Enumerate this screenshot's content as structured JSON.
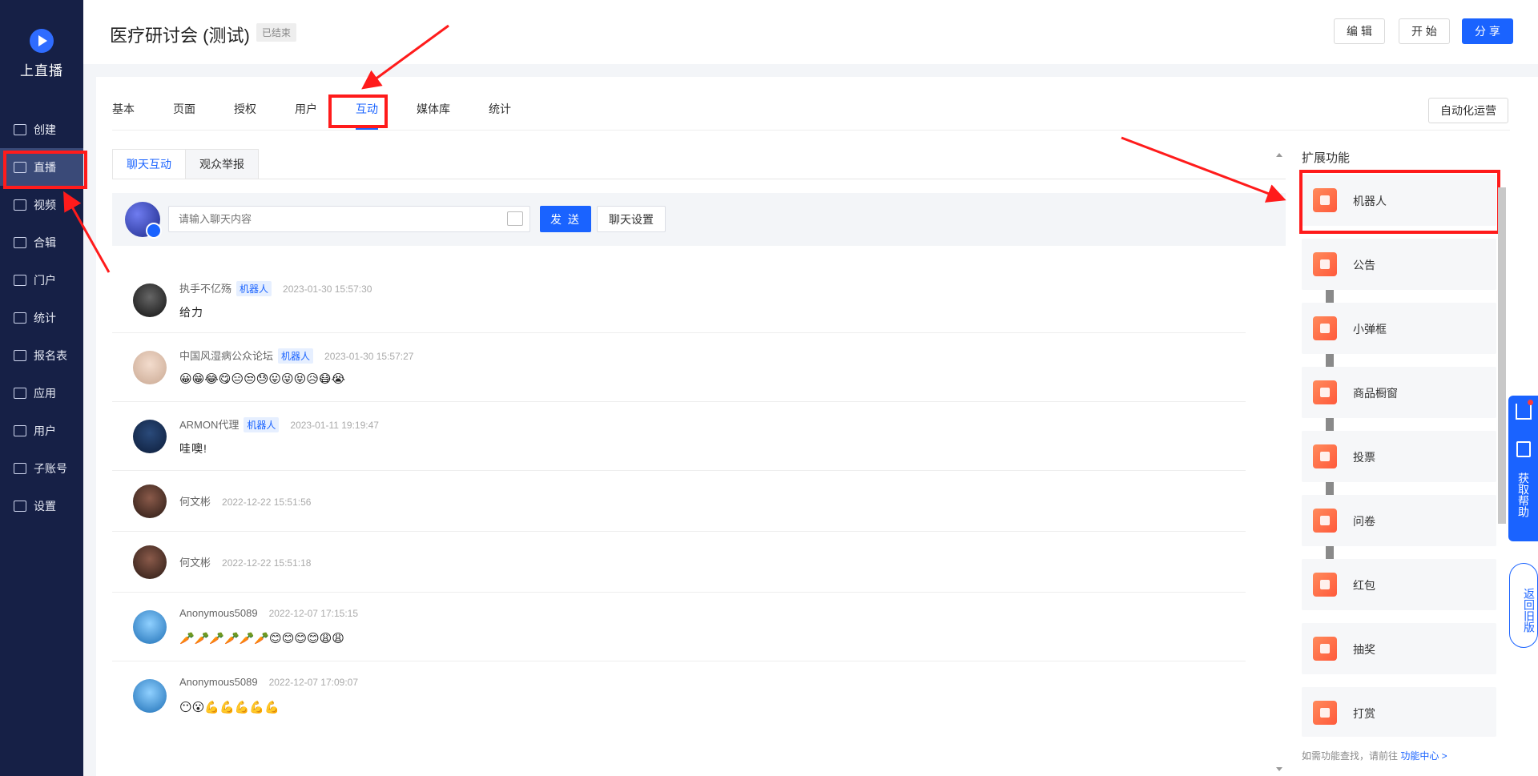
{
  "app": {
    "logo_text": "上直播"
  },
  "sidebar": {
    "items": [
      {
        "label": "创建",
        "icon": "plus-square-icon"
      },
      {
        "label": "直播",
        "icon": "live-icon"
      },
      {
        "label": "视频",
        "icon": "video-icon"
      },
      {
        "label": "合辑",
        "icon": "collection-icon"
      },
      {
        "label": "门户",
        "icon": "monitor-icon"
      },
      {
        "label": "统计",
        "icon": "pie-chart-icon"
      },
      {
        "label": "报名表",
        "icon": "mail-icon"
      },
      {
        "label": "应用",
        "icon": "apps-icon"
      },
      {
        "label": "用户",
        "icon": "users-icon"
      },
      {
        "label": "子账号",
        "icon": "sub-account-icon"
      },
      {
        "label": "设置",
        "icon": "gear-icon"
      }
    ]
  },
  "header": {
    "title": "医疗研讨会 (测试)",
    "status": "已结束",
    "edit_label": "编 辑",
    "start_label": "开 始",
    "share_label": "分 享"
  },
  "tabs": [
    "基本",
    "页面",
    "授权",
    "用户",
    "互动",
    "媒体库",
    "统计"
  ],
  "auto_ops_label": "自动化运营",
  "subtabs": [
    "聊天互动",
    "观众举报"
  ],
  "chat": {
    "input_placeholder": "请输入聊天内容",
    "send_label": "发 送",
    "settings_label": "聊天设置"
  },
  "messages": [
    {
      "name": "执手不亿殇",
      "badge": "机器人",
      "time": "2023-01-30 15:57:30",
      "text": "给力"
    },
    {
      "name": "中国风湿病公众论坛",
      "badge": "机器人",
      "time": "2023-01-30 15:57:27",
      "text": "😀😁😂😋😑😒😓😛😜😝😥😷😭"
    },
    {
      "name": "ARMON代理",
      "badge": "机器人",
      "time": "2023-01-11 19:19:47",
      "text": "哇噢!"
    },
    {
      "name": "何文彬",
      "badge": "",
      "time": "2022-12-22 15:51:56",
      "text": ""
    },
    {
      "name": "何文彬",
      "badge": "",
      "time": "2022-12-22 15:51:18",
      "text": ""
    },
    {
      "name": "Anonymous5089",
      "badge": "",
      "time": "2022-12-07 17:15:15",
      "text": "🥕🥕🥕🥕🥕🥕😊😊😊😊😩😩"
    },
    {
      "name": "Anonymous5089",
      "badge": "",
      "time": "2022-12-07 17:09:07",
      "text": "😶😮💪💪💪💪💪"
    }
  ],
  "extensions": {
    "title": "扩展功能",
    "items": [
      "机器人",
      "公告",
      "小弹框",
      "商品橱窗",
      "投票",
      "问卷",
      "红包",
      "抽奖",
      "打赏"
    ],
    "footer_text": "如需功能查找，请前往 ",
    "footer_link": "功能中心 >"
  },
  "float_tools": {
    "help_text": "获取帮助",
    "old_version_text": "返回旧版"
  },
  "colors": {
    "primary": "#1a63ff",
    "sidebar_bg": "#162046",
    "annotation_red": "#ff1b1b"
  }
}
